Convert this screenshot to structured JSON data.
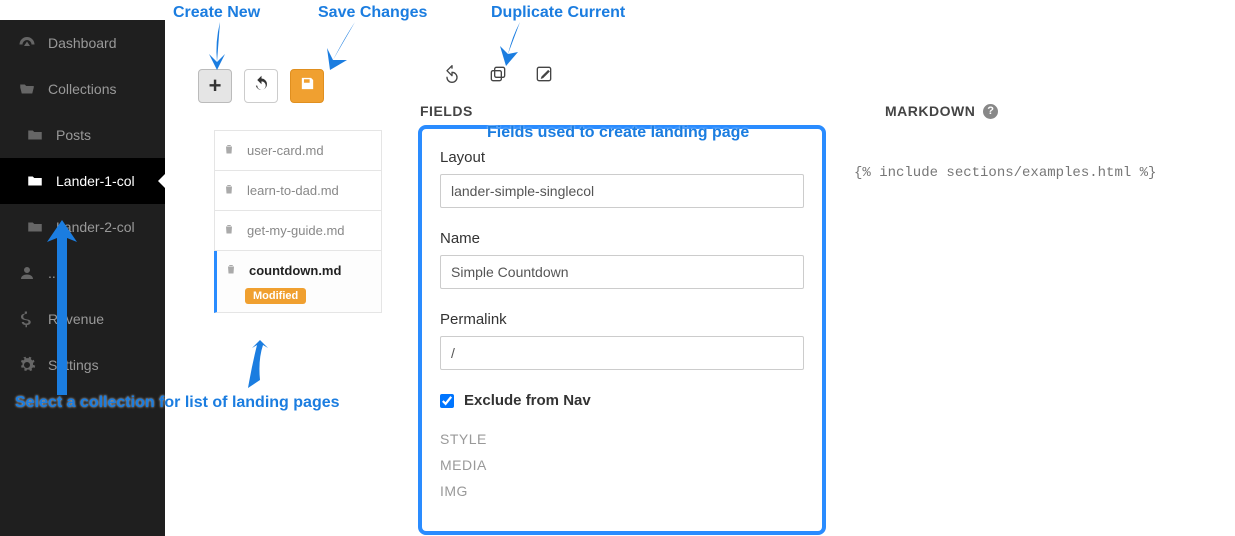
{
  "sidebar": {
    "items": [
      {
        "label": "Dashboard",
        "icon": "gauge"
      },
      {
        "label": "Collections",
        "icon": "folder-open"
      },
      {
        "label": "Posts",
        "icon": "folder"
      },
      {
        "label": "Lander-1-col",
        "icon": "folder"
      },
      {
        "label": "Lander-2-col",
        "icon": "folder"
      },
      {
        "label": "...s",
        "icon": "user"
      },
      {
        "label": "Revenue",
        "icon": "dollar"
      },
      {
        "label": "Settings",
        "icon": "gear"
      }
    ]
  },
  "files": [
    {
      "name": "user-card.md"
    },
    {
      "name": "learn-to-dad.md"
    },
    {
      "name": "get-my-guide.md"
    },
    {
      "name": "countdown.md",
      "badge": "Modified"
    }
  ],
  "headings": {
    "fields": "FIELDS",
    "markdown": "MARKDOWN"
  },
  "form": {
    "layout_label": "Layout",
    "layout_value": "lander-simple-singlecol",
    "name_label": "Name",
    "name_value": "Simple Countdown",
    "permalink_label": "Permalink",
    "permalink_value": "/",
    "exclude_label": "Exclude from Nav",
    "exclude_checked": true,
    "section_style": "STYLE",
    "section_media": "MEDIA",
    "section_img": "IMG"
  },
  "markdown": {
    "content": "{% include sections/examples.html %}"
  },
  "annotations": {
    "create_new": "Create New",
    "save_changes": "Save Changes",
    "duplicate_current": "Duplicate Current",
    "fields_desc": "Fields used to create landing page",
    "select_coll": "Select a collection for list of landing pages"
  }
}
